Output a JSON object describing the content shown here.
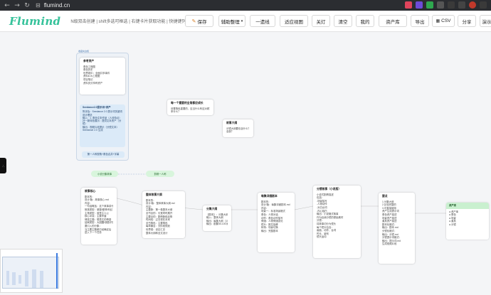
{
  "browser": {
    "url": "flumind.cn",
    "back_icon": "←",
    "forward_icon": "→",
    "reload_icon": "↻",
    "site_icon": "⊟"
  },
  "app": {
    "logo": "Flumind",
    "subtitle": "N级双击创建 | shift多选可框选 | 右键卡片获取功能 | 快捷键列表"
  },
  "toolbar": {
    "save": "保存",
    "assist": "辅助整理",
    "one_line": "一遗线",
    "fit_view": "适应视图",
    "close": "关灯",
    "clear": "清空",
    "mine": "我的",
    "assets": "资产库",
    "export": "导出",
    "csv": "CSV",
    "share": "分享",
    "demo": "演示"
  },
  "canvas": {
    "group_tag": "收藏夹边框",
    "group_card": {
      "title": "参考资产",
      "lines": [
        "角色工程图",
        "角色历史",
        "世界观中：全面共享事件",
        "",
        "资料6.0v工程图",
        "项目笔记",
        "",
        "资料页分享称资产"
      ]
    },
    "group_blue_card": {
      "title": "Seedance2.0提示词+资产",
      "lines": [
        "所涉及：Seedance 2.0 提示词关键词",
        "设计理念",
        "输入：1. 角色文本作品（人设特点）",
        "补一新特色展示：提供文本资产（分镜）",
        "输出：视频片段提示（分镜文本）",
        "Seedance 2.0 生成"
      ]
    },
    "group_blue_card2": "第一人称视角+角色合并+字幕",
    "mid_card": {
      "title": "每一个重要的全角都应成长",
      "lines": [
        "设置角色重要的，应当什么有应对着？",
        "来什么？"
      ]
    },
    "story_card": {
      "title": "故事大纲",
      "lines": [
        "分镜大纲要包含什么？",
        "全部？"
      ]
    },
    "pill_left": "小说分集故事",
    "pill_right": "剪辑一人称",
    "cards": [
      {
        "title": "故事核心",
        "lines": [
          "剧本的：",
          "设计/版：故事核心.md",
          "内容：",
          "一句话概括：这个故事讲什么",
          "故事类型：悬疑/爱情/科幻",
          "主角类型：谁是主人公",
          "核心冲突：主要矛盾",
          "情感主题：想表达的情感",
          "结局类型：大团圆/悲剧/开放",
          "要引入的分集：",
          "当主要主题都已经确定后",
          "进入下一个任务"
        ]
      },
      {
        "title": "整体故事大纲",
        "lines": [
          "剧本的：",
          "设计/版：整体故事大纲.md",
          "内容：",
          "主要脉：第一卷剧本大纲",
          "全书目的：长宽同时展开",
          "主要目的：剧情脉络走势",
          "时间线：过去现在未来",
          "全书角色：主要角色",
          "每章篇目：分阶段规划",
          "世界观：设定汇总",
          "整体大纲和全文设计"
        ]
      },
      {
        "title": "分集大纲",
        "lines": [
          "【剧本】：分集大纲篇",
          "输入：整体大纲",
          "输出：每集大纲（10集一组，共60~80集）",
          "输出：剧集50-100字"
        ]
      },
      {
        "title": "每集详细剧本",
        "lines": [
          "剧本的：",
          "设计/版：每集详细剧本.md",
          "内容：",
          "场景一：标准场景格式",
          "角色：人物对话",
          "动作：角色动作描写",
          "情绪：人物情绪变化",
          "镜头：推拉摇移",
          "转场：场景切换",
          "输出：完整剧本"
        ]
      },
      {
        "title": "分镜故事（小说版）",
        "lines": [
          "小说式剧情描述",
          "包括：",
          "-场景描写",
          "-人物动作",
          "-对白台词",
          "-内心独白",
          "输出：小说格式故事",
          "作为后续分镜的原始素材",
          "分镜：",
          "将故事切分为镜头",
          "每个镜头包含：",
          "画面、动作、台词",
          "时长、景别",
          "镜头运动"
        ]
      },
      {
        "title": "要点",
        "lines": [
          "1.分集大纲",
          "2.比较完整的",
          "3.可直接使用",
          "资产生成提示词",
          "角色资产描述",
          "场景资产描述",
          "道具资产描述",
          "",
          "剧本化格式：",
          "输出：剧本.md",
          "",
          "分镜化格式：",
          "输出：分镜.md",
          "",
          "分镜提示词格式：",
          "输出：提示词.md",
          "生成视频片段"
        ]
      }
    ],
    "final_card": {
      "title": "资产库",
      "lines": [
        "● 资产库",
        "",
        "● 角色",
        "● 场景",
        "● 道具",
        "● 分镜"
      ]
    }
  },
  "side_handle": "∴",
  "colors": {
    "brand": "#35c29a",
    "pill_bg": "#d8f5dc",
    "blue_card": "#dbeaf8"
  }
}
